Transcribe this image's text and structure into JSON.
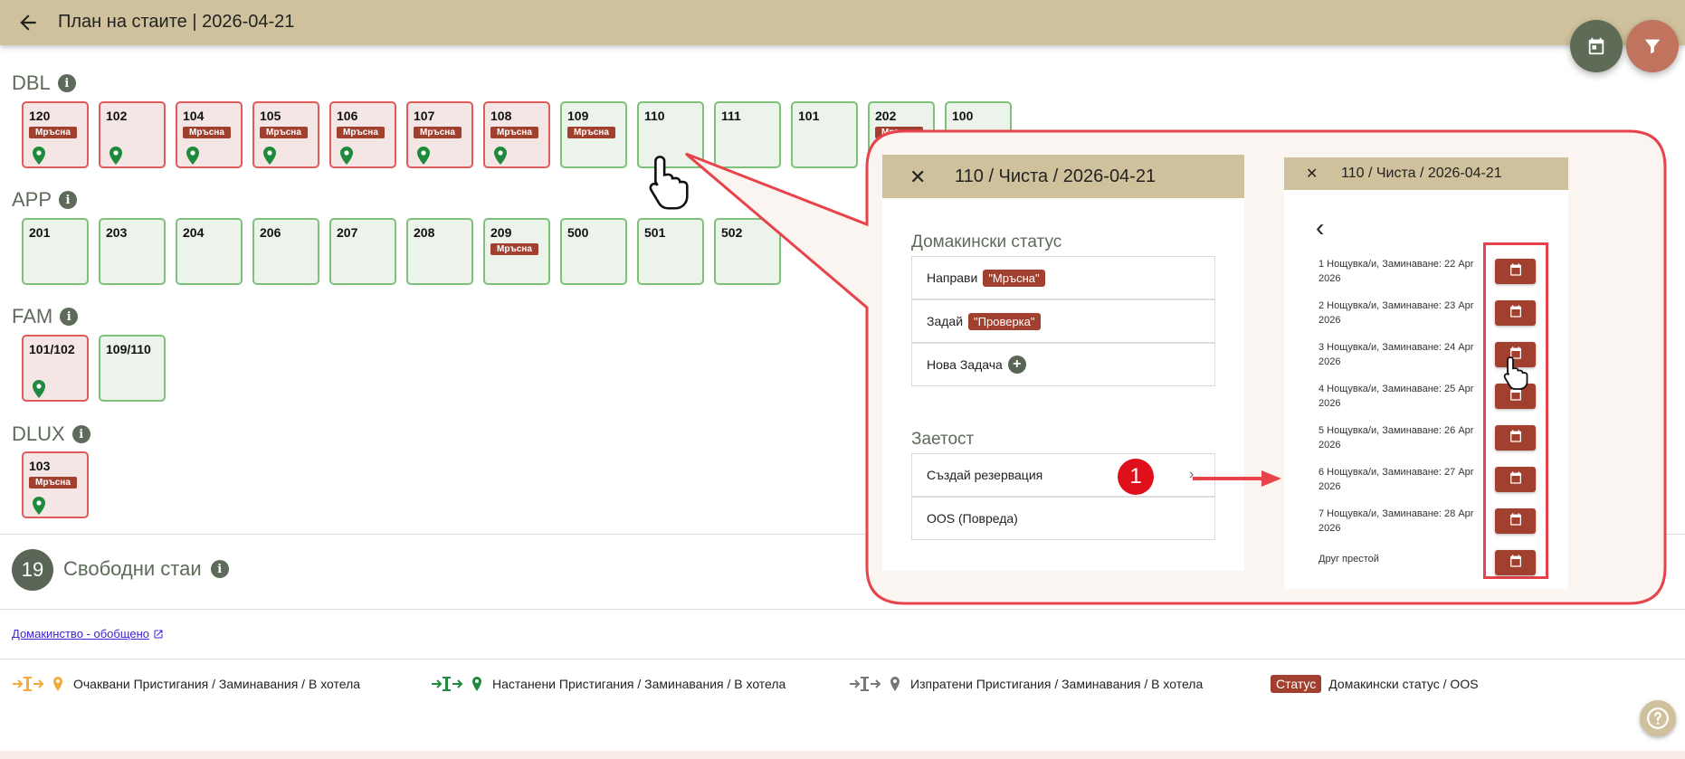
{
  "header": {
    "title": "План на стаите | 2026-04-21",
    "back_icon": "arrow-left-icon",
    "calendar_icon": "calendar-icon",
    "filter_icon": "filter-icon"
  },
  "colors": {
    "header_bg": "#cfc19b",
    "dirty_border": "#e05b5b",
    "clean_border": "#7dc17b",
    "status_chip": "#a2402f",
    "accent_green": "#5a6655"
  },
  "sections": [
    {
      "name": "DBL",
      "rooms": [
        {
          "number": "120",
          "status": "Мръсна",
          "pin": true,
          "dirty": true
        },
        {
          "number": "102",
          "status": "",
          "pin": true,
          "dirty": true
        },
        {
          "number": "104",
          "status": "Мръсна",
          "pin": true,
          "dirty": true
        },
        {
          "number": "105",
          "status": "Мръсна",
          "pin": true,
          "dirty": true
        },
        {
          "number": "106",
          "status": "Мръсна",
          "pin": true,
          "dirty": true
        },
        {
          "number": "107",
          "status": "Мръсна",
          "pin": true,
          "dirty": true
        },
        {
          "number": "108",
          "status": "Мръсна",
          "pin": true,
          "dirty": true
        },
        {
          "number": "109",
          "status": "Мръсна",
          "pin": false,
          "dirty": false
        },
        {
          "number": "110",
          "status": "",
          "pin": false,
          "dirty": false
        },
        {
          "number": "111",
          "status": "",
          "pin": false,
          "dirty": false
        },
        {
          "number": "101",
          "status": "",
          "pin": false,
          "dirty": false
        },
        {
          "number": "202",
          "status": "Мръсна",
          "pin": false,
          "dirty": false
        },
        {
          "number": "100",
          "status": "",
          "pin": false,
          "dirty": false
        }
      ]
    },
    {
      "name": "APP",
      "rooms": [
        {
          "number": "201",
          "status": "",
          "pin": false,
          "dirty": false
        },
        {
          "number": "203",
          "status": "",
          "pin": false,
          "dirty": false
        },
        {
          "number": "204",
          "status": "",
          "pin": false,
          "dirty": false
        },
        {
          "number": "206",
          "status": "",
          "pin": false,
          "dirty": false
        },
        {
          "number": "207",
          "status": "",
          "pin": false,
          "dirty": false
        },
        {
          "number": "208",
          "status": "",
          "pin": false,
          "dirty": false
        },
        {
          "number": "209",
          "status": "Мръсна",
          "pin": false,
          "dirty": false
        },
        {
          "number": "500",
          "status": "",
          "pin": false,
          "dirty": false
        },
        {
          "number": "501",
          "status": "",
          "pin": false,
          "dirty": false
        },
        {
          "number": "502",
          "status": "",
          "pin": false,
          "dirty": false
        }
      ]
    },
    {
      "name": "FAM",
      "rooms": [
        {
          "number": "101/102",
          "status": "",
          "pin": true,
          "dirty": true
        },
        {
          "number": "109/110",
          "status": "",
          "pin": false,
          "dirty": false
        }
      ]
    },
    {
      "name": "DLUX",
      "rooms": [
        {
          "number": "103",
          "status": "Мръсна",
          "pin": true,
          "dirty": true
        }
      ]
    }
  ],
  "free_rooms": {
    "count": "19",
    "label": "Свободни стаи"
  },
  "summary_link": "Домакинство - обобщено",
  "legend": [
    {
      "text": "Очаквани Пристигания / Заминавания / В хотела",
      "color": "#f2a93b"
    },
    {
      "text": "Настанени Пристигания / Заминавания / В хотела",
      "color": "#1f8a3b"
    },
    {
      "text": "Изпратени Пристигания / Заминавания / В хотела",
      "color": "#777777"
    },
    {
      "chip": "Статус",
      "text": "Домакински статус / OOS"
    }
  ],
  "callout": {
    "left_panel": {
      "title": "110 / Чиста / 2026-04-21",
      "housekeeping_title": "Домакински статус",
      "make_label": "Направи",
      "make_chip": "\"Мръсна\"",
      "assign_label": "Задай",
      "assign_chip": "\"Проверка\"",
      "new_task": "Нова Задача",
      "occupancy_title": "Заетост",
      "create_reservation": "Създай резервация",
      "oos": "OOS (Повреда)",
      "step_number": "1"
    },
    "right_panel": {
      "title": "110 / Чиста / 2026-04-21",
      "options": [
        "1 Нощувка/и, Заминаване: 22 Apr 2026",
        "2 Нощувка/и, Заминаване: 23 Apr 2026",
        "3 Нощувка/и, Заминаване: 24 Apr 2026",
        "4 Нощувка/и, Заминаване: 25 Apr 2026",
        "5 Нощувка/и, Заминаване: 26 Apr 2026",
        "6 Нощувка/и, Заминаване: 27 Apr 2026",
        "7 Нощувка/и, Заминаване: 28 Apr 2026",
        "Друг престой"
      ]
    }
  }
}
